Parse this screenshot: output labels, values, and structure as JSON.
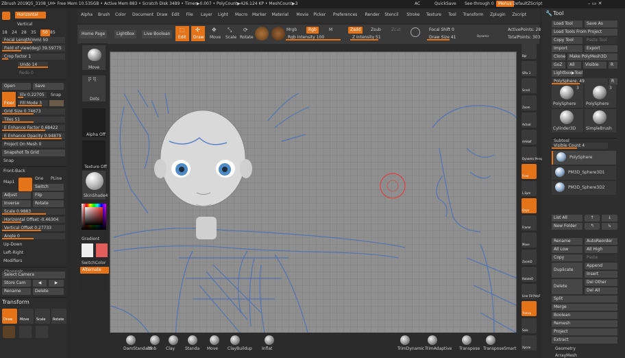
{
  "topbar": {
    "title": "ZBrush 2019",
    "file": "Q5_3108_UH",
    "status": "• Free Mem 10.535GB • Active Mem 883 • Scratch Disk 3489 • Timer▶0.007 • PolyCount▶426.124 KP • MeshCount▶3",
    "ac": "AC",
    "quicksave": "QuickSave",
    "seethrough": "See-through  0",
    "menus": "Menus",
    "defaultscript": "DefaultZScript"
  },
  "menus": [
    "Alpha",
    "Brush",
    "Color",
    "Document",
    "Draw",
    "Edit",
    "File",
    "Layer",
    "Light",
    "Macro",
    "Marker",
    "Material",
    "Movie",
    "Picker",
    "Preferences",
    "Render",
    "Stencil",
    "Stroke",
    "Texture",
    "Tool",
    "Transform",
    "Zplugin",
    "Zscript"
  ],
  "left": {
    "horizontal": "Horizontal",
    "vertical": "Vertical",
    "numbers": [
      "18",
      "24",
      "28",
      "35",
      "50",
      "85"
    ],
    "focal": "Focal Length(mm) 50",
    "fov": "Field of view(deg) 39.59775",
    "crop": "Crop factor 1",
    "undo": "Undo 14",
    "redo": "Redo 0",
    "open": "Open",
    "save": "Save",
    "elv": "Elv 0.22705",
    "snap": "Snap",
    "fillmode": "Fill Mode 3",
    "floor": "Floor",
    "gridsize": "Grid Size 0.74673",
    "tiles": "Tiles 51",
    "enhance_factor": "E Enhance Factor 0.68422",
    "enhance_opacity": "E Enhance Opacity 0.94879",
    "project_on_mesh": "Project On Mesh 0",
    "snapshot": "Snapshot To Grid",
    "snap2": "Snap",
    "frontback": "Front-Back",
    "map1": "Map1",
    "one": "One",
    "pline": "PLine",
    "switch": "Switch",
    "adjust": "Adjust",
    "flip": "Flip",
    "inverse": "Inverse",
    "rotate": "Rotate",
    "scale": "Scale 0.9883",
    "hoffset": "Horizontal Offset -0.46304",
    "voffset": "Vertical Offset 0.27733",
    "angle": "Angle 0",
    "updown": "Up-Down",
    "leftright": "Left-Right",
    "modifiers": "Modifiers",
    "channels": "Channels",
    "select_camera": "Select Camera",
    "store_cam": "Store Cam",
    "rename": "Rename",
    "delete": "Delete",
    "transform": "Transform",
    "t_icons": [
      "Draw",
      "Move",
      "Scale",
      "Rotate"
    ]
  },
  "shelf": {
    "move": "Move",
    "dots": "Dots",
    "alpha_off": "Alpha Off",
    "texture_off": "Texture Off",
    "material": "SkinShade4",
    "gradient": "Gradient",
    "switchcolor": "SwitchColor",
    "alternate": "Alternate"
  },
  "toolbar": {
    "home": "Home Page",
    "lightbox": "LightBox",
    "live_boolean": "Live Boolean",
    "edit": "Edit",
    "draw": "Draw",
    "move": "Move",
    "scale": "Scale",
    "rotate": "Rotate",
    "mrgb": "Mrgb",
    "rgb": "Rgb",
    "m": "M",
    "zadd": "Zadd",
    "zsub": "Zsub",
    "zcut": "Zcut",
    "rgb_intensity": "Rgb Intensity 100",
    "z_intensity": "Z Intensity 51",
    "focal_shift": "Focal Shift 0",
    "draw_size": "Draw Size 41",
    "dynamic": "Dynamic",
    "active_points": "ActivePoints: 28",
    "total_points": "TotalPoints: 303"
  },
  "right_tools": [
    "Bpr",
    "SPix 3",
    "Scroll",
    "Zoom",
    "Actual",
    "AAHalf",
    "Dynamic Persp",
    "Floor",
    "L.Sym",
    "Qxyz",
    "Frame",
    "Move",
    "ZoomD",
    "RotateD",
    "Line Fill PolyF",
    "Transp",
    "Solo",
    "Xpose"
  ],
  "tool_panel": {
    "title": "Tool",
    "load_tool": "Load Tool",
    "save_as": "Save As",
    "load_tools_project": "Load Tools From Project",
    "copy_tool": "Copy Tool",
    "paste_tool": "Paste Tool",
    "import": "Import",
    "export": "Export",
    "clone": "Clone",
    "make_polymesh": "Make PolyMesh3D",
    "goz": "GoZ",
    "all": "All",
    "visible": "Visible",
    "r": "R",
    "lightbox_tools": "Lightbox▶Tools",
    "polysphere_slider": "PolySphere. 49",
    "thumbs": [
      "PolySphere",
      "PolySphere",
      "Cylinder3D",
      "SimpleBrush"
    ],
    "thumb_counts": [
      "3",
      "3"
    ],
    "subtool": "Subtool",
    "visible_count": "Visible Count 4",
    "subtools": [
      "PolySphere",
      "PM3D_Sphere3D1",
      "PM3D_Sphere3D2"
    ],
    "list_all": "List All",
    "new_folder": "New Folder",
    "rename": "Rename",
    "autoreorder": "AutoReorder",
    "all_low": "All Low",
    "all_high": "All High",
    "copy": "Copy",
    "paste": "Paste",
    "duplicate": "Duplicate",
    "append": "Append",
    "insert": "Insert",
    "delete": "Delete",
    "del_other": "Del Other",
    "del_all": "Del All",
    "split": "Split",
    "merge": "Merge",
    "boolean": "Boolean",
    "remesh": "Remesh",
    "project": "Project",
    "extract": "Extract",
    "geometry": "Geometry",
    "arraymesh": "ArrayMesh"
  },
  "brushes": [
    "DamStandard",
    "Blob",
    "Clay",
    "Standa",
    "Move",
    "ClayBuildup",
    "Inflat",
    "TrimDynamic",
    "TrimAdaptive",
    "Transpose",
    "TransposeSmart"
  ],
  "colors": {
    "accent": "#e4731a",
    "bg": "#2b2b2b",
    "canvas": "#8f8f8f",
    "sketch": "#4a6fb8"
  }
}
